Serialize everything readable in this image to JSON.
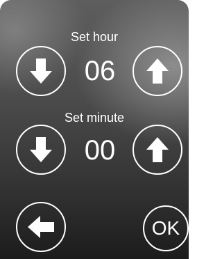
{
  "hour": {
    "label": "Set hour",
    "value": "06",
    "decrease_icon": "arrow-down-icon",
    "increase_icon": "arrow-up-icon"
  },
  "minute": {
    "label": "Set minute",
    "value": "00",
    "decrease_icon": "arrow-down-icon",
    "increase_icon": "arrow-up-icon"
  },
  "footer": {
    "back_icon": "arrow-left-icon",
    "ok_label": "OK"
  },
  "colors": {
    "foreground": "#ffffff",
    "panel_top": "#5e5e5e",
    "panel_bottom": "#1c1c1c"
  }
}
